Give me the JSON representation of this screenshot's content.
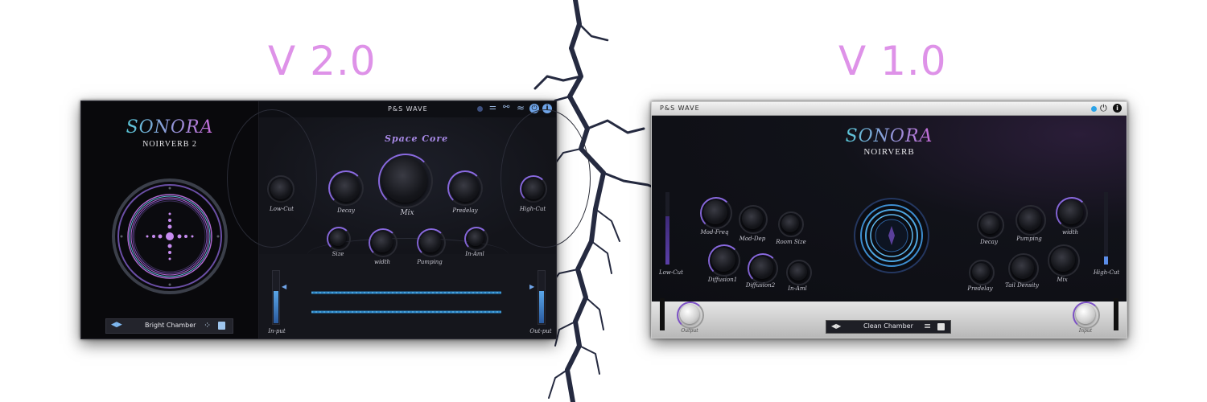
{
  "labels": {
    "v2": "V 2.0",
    "v1": "V 1.0"
  },
  "v2": {
    "brand": "P&S WAVE",
    "logo": "SONORA",
    "product": "NOIRVERB 2",
    "section_title": "Space Core",
    "knobs": {
      "low_cut": "Low-Cut",
      "decay": "Decay",
      "mix": "Mix",
      "predelay": "Predelay",
      "high_cut": "High-Cut",
      "size": "Size",
      "width": "width",
      "pumping": "Pumping",
      "in_aml": "In-Aml"
    },
    "input_label": "In-put",
    "output_label": "Out-put",
    "preset": "Bright Chamber",
    "colors": {
      "accent": "#8a6ae0",
      "wave": "#3fa7d6",
      "logo_start": "#59c7d8",
      "logo_end": "#c66ad8"
    },
    "toolbar_icons": [
      "dot-icon",
      "sliders-icon",
      "routing-icon",
      "tilde-icon",
      "power-icon",
      "info-icon"
    ]
  },
  "v1": {
    "brand": "P&S WAVE",
    "logo": "SONORA",
    "product": "NOIRVERB",
    "knobs": {
      "mod_freq": "Mod-Freq",
      "mod_dep": "Mod-Dep",
      "room_size": "Room Size",
      "diffusion1": "Diffusion1",
      "diffusion2": "Diffusion2",
      "in_aml": "In-Aml",
      "decay": "Decay",
      "pumping": "Pumping",
      "width": "width",
      "predelay": "Predelay",
      "tail_density": "Tail Density",
      "mix": "Mix"
    },
    "low_cut": "Low-Cut",
    "high_cut": "High-Cut",
    "output": "Output",
    "input": "Input",
    "preset": "Clean Chamber",
    "colors": {
      "accent": "#7e52c8",
      "meter": "#5b3fa8"
    }
  }
}
